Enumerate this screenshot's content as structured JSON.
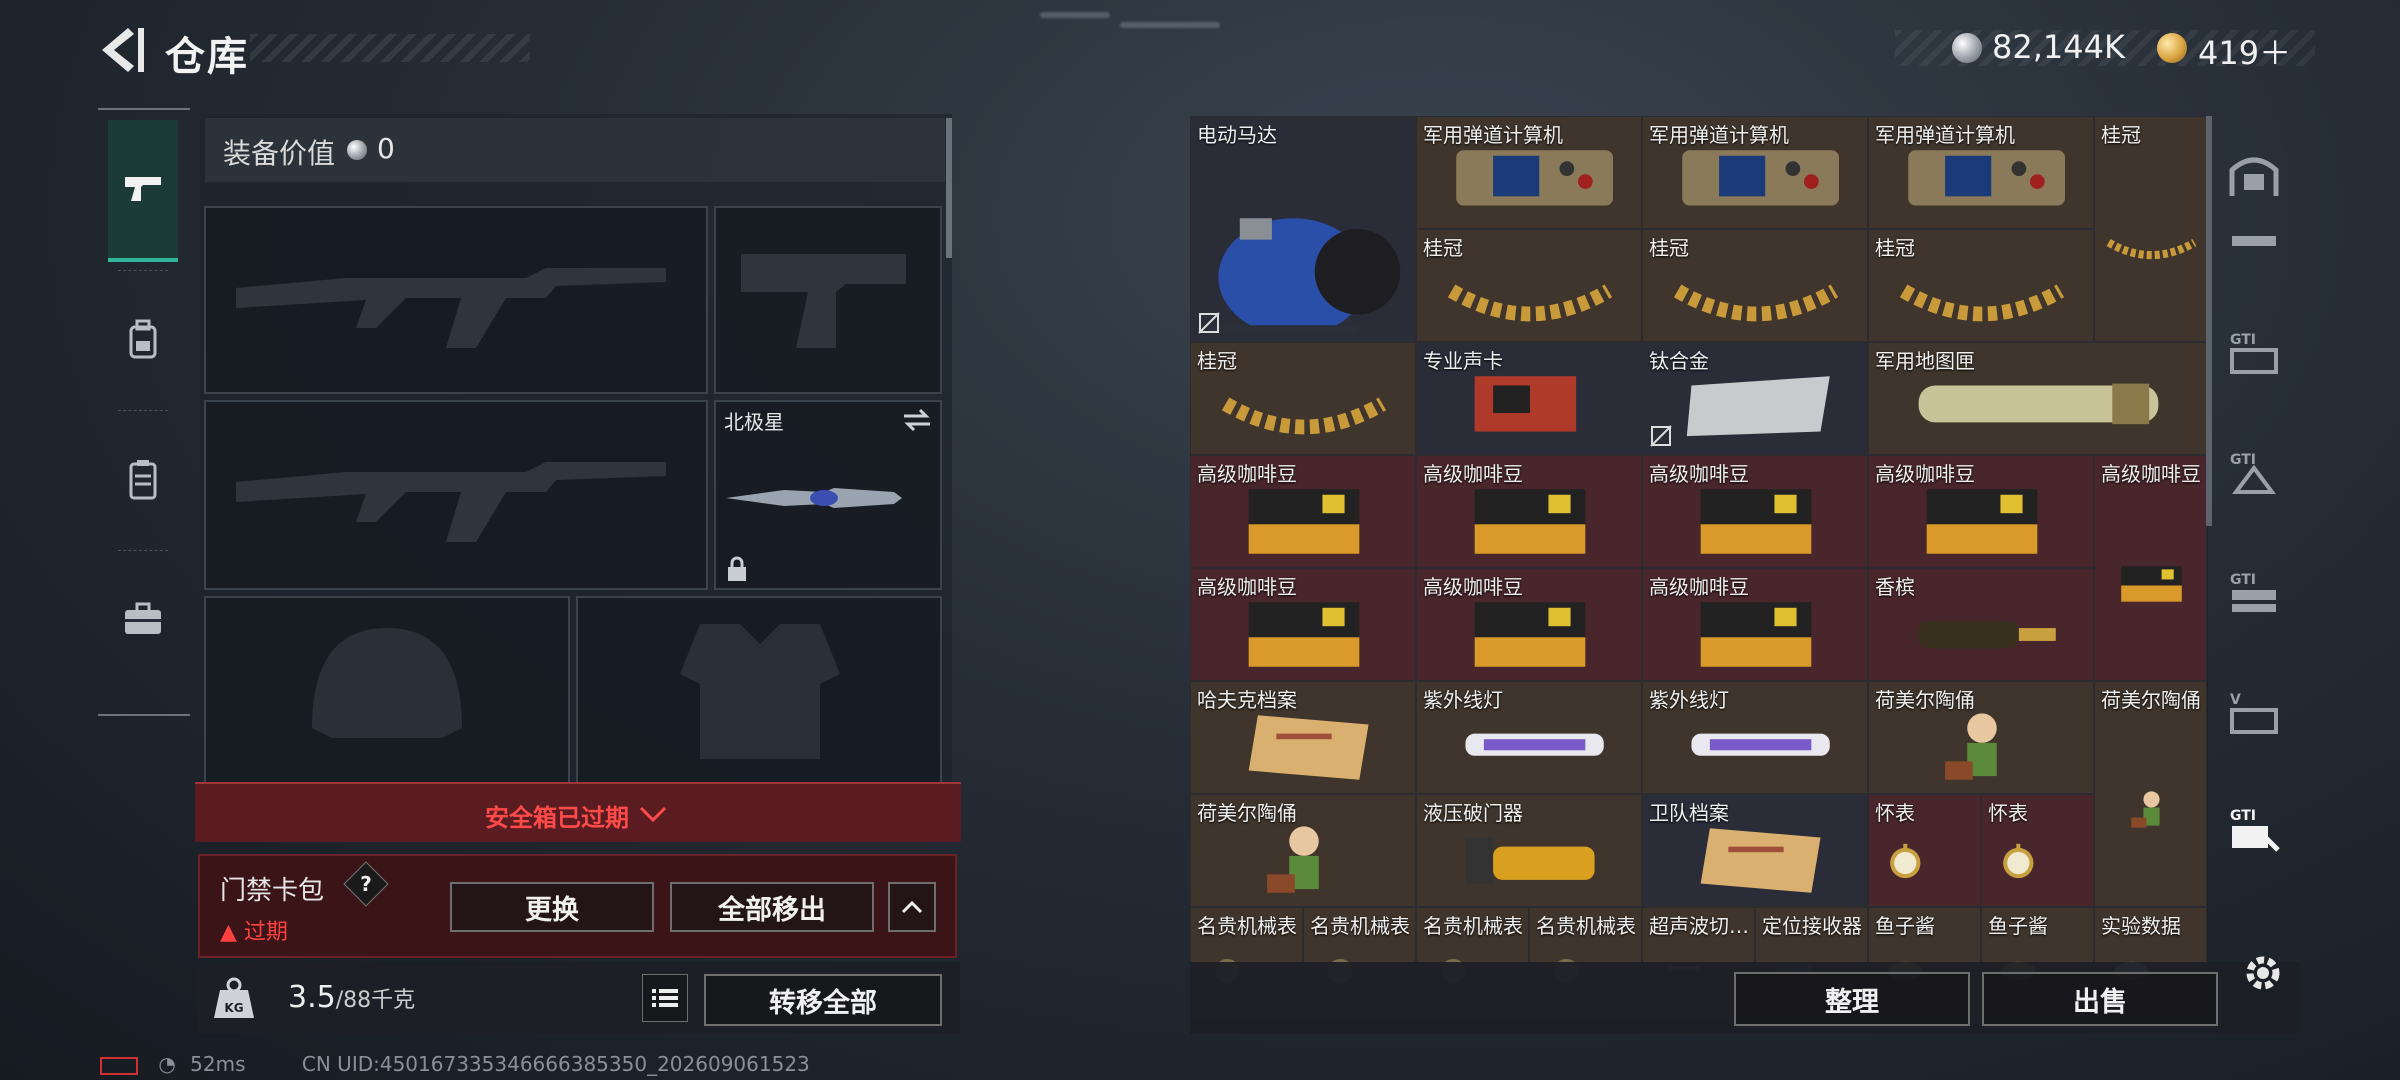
{
  "header": {
    "title": "仓库"
  },
  "currency": [
    {
      "icon": "silver-coin-icon",
      "value": "82,144K",
      "color": "#b8bcc4"
    },
    {
      "icon": "gold-token-icon",
      "value": "419＋",
      "color": "#d9a441"
    }
  ],
  "sidebar": {
    "tabs": [
      {
        "icon": "pistol-icon",
        "active": true
      },
      {
        "icon": "backpack-icon",
        "active": false
      },
      {
        "icon": "vest-icon",
        "active": false
      },
      {
        "icon": "briefcase-icon",
        "active": false
      }
    ]
  },
  "loadout": {
    "equip_value_label": "装备价值",
    "equip_value": "0",
    "melee_label": "北极星"
  },
  "safebox": {
    "banner": "安全箱已过期"
  },
  "keycard": {
    "title": "门禁卡包",
    "help": "?",
    "expired": "过期",
    "replace_label": "更换",
    "move_all_label": "全部移出"
  },
  "weight": {
    "current": "3.5",
    "capacity": "/88千克",
    "transfer_all_label": "转移全部"
  },
  "storage": {
    "items": [
      {
        "label": "电动马达",
        "icon": "electric-motor-icon",
        "bg": "dark"
      },
      {
        "label": "军用弹道计算机",
        "icon": "ballistic-computer-icon",
        "bg": "brown"
      },
      {
        "label": "军用弹道计算机",
        "icon": "ballistic-computer-icon",
        "bg": "brown"
      },
      {
        "label": "军用弹道计算机",
        "icon": "ballistic-computer-icon",
        "bg": "brown"
      },
      {
        "label": "桂冠",
        "icon": "laurel-crown-icon",
        "bg": "brown"
      },
      {
        "label": "桂冠",
        "icon": "laurel-crown-icon",
        "bg": "brown"
      },
      {
        "label": "桂冠",
        "icon": "laurel-crown-icon",
        "bg": "brown"
      },
      {
        "label": "桂冠",
        "icon": "laurel-crown-icon",
        "bg": "brown"
      },
      {
        "label": "桂冠",
        "icon": "laurel-crown-icon",
        "bg": "brown"
      },
      {
        "label": "专业声卡",
        "icon": "sound-card-icon",
        "bg": "dark"
      },
      {
        "label": "钛合金",
        "icon": "titanium-plate-icon",
        "bg": "dark"
      },
      {
        "label": "军用地图匣",
        "icon": "map-tube-icon",
        "bg": "brown"
      },
      {
        "label": "高级咖啡豆",
        "icon": "coffee-bag-icon",
        "bg": "red"
      },
      {
        "label": "高级咖啡豆",
        "icon": "coffee-bag-icon",
        "bg": "red"
      },
      {
        "label": "高级咖啡豆",
        "icon": "coffee-bag-icon",
        "bg": "red"
      },
      {
        "label": "高级咖啡豆",
        "icon": "coffee-bag-icon",
        "bg": "red"
      },
      {
        "label": "高级咖啡豆",
        "icon": "coffee-bag-icon",
        "bg": "red"
      },
      {
        "label": "高级咖啡豆",
        "icon": "coffee-bag-icon",
        "bg": "red"
      },
      {
        "label": "高级咖啡豆",
        "icon": "coffee-bag-icon",
        "bg": "red"
      },
      {
        "label": "高级咖啡豆",
        "icon": "coffee-bag-icon",
        "bg": "red"
      },
      {
        "label": "香槟",
        "icon": "champagne-bottle-icon",
        "bg": "red"
      },
      {
        "label": "哈夫克档案",
        "icon": "document-folder-icon",
        "bg": "brown"
      },
      {
        "label": "紫外线灯",
        "icon": "uv-lamp-icon",
        "bg": "brown"
      },
      {
        "label": "紫外线灯",
        "icon": "uv-lamp-icon",
        "bg": "brown"
      },
      {
        "label": "荷美尔陶俑",
        "icon": "figurine-icon",
        "bg": "brown"
      },
      {
        "label": "荷美尔陶俑",
        "icon": "figurine-icon",
        "bg": "brown"
      },
      {
        "label": "荷美尔陶俑",
        "icon": "figurine-icon",
        "bg": "brown"
      },
      {
        "label": "液压破门器",
        "icon": "hydraulic-breacher-icon",
        "bg": "brown"
      },
      {
        "label": "卫队档案",
        "icon": "document-folder-icon",
        "bg": "dark"
      },
      {
        "label": "怀表",
        "icon": "pocket-watch-icon",
        "bg": "red"
      },
      {
        "label": "怀表",
        "icon": "pocket-watch-icon",
        "bg": "red"
      },
      {
        "label": "名贵机械表",
        "icon": "wristwatch-icon",
        "bg": "brown"
      },
      {
        "label": "名贵机械表",
        "icon": "wristwatch-icon",
        "bg": "brown"
      },
      {
        "label": "名贵机械表",
        "icon": "wristwatch-icon",
        "bg": "brown"
      },
      {
        "label": "名贵机械表",
        "icon": "wristwatch-icon",
        "bg": "brown"
      },
      {
        "label": "超声波切…",
        "icon": "ultrasonic-cutter-icon",
        "bg": "brown"
      },
      {
        "label": "定位接收器",
        "icon": "locator-receiver-icon",
        "bg": "brown"
      },
      {
        "label": "鱼子酱",
        "icon": "caviar-tin-icon",
        "bg": "brown"
      },
      {
        "label": "鱼子酱",
        "icon": "caviar-tin-icon",
        "bg": "brown"
      },
      {
        "label": "实验数据",
        "icon": "data-disk-icon",
        "bg": "brown"
      }
    ]
  },
  "actions": {
    "sort_label": "整理",
    "sell_label": "出售"
  },
  "right_sidebar": {
    "icons": [
      "vault-icon",
      "storage-1-icon",
      "storage-2-icon",
      "storage-3-icon",
      "storage-4-icon",
      "storage-5-icon"
    ]
  },
  "status": {
    "ping": "52ms",
    "uid": "CN UID:450167335346666385350_202609061523"
  }
}
